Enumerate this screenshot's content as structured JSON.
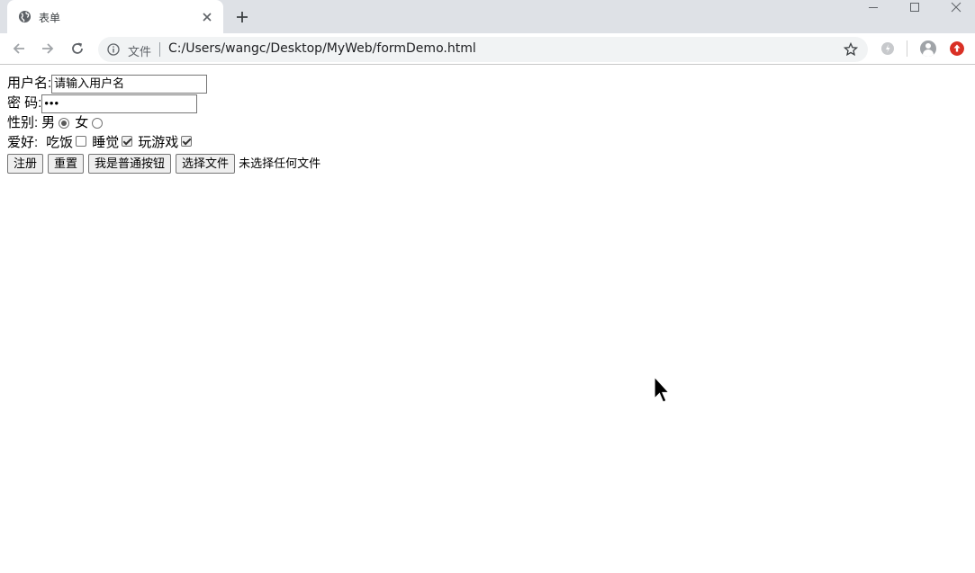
{
  "browser": {
    "tab": {
      "title": "表单"
    },
    "address_bar": {
      "scheme_label": "文件",
      "url": "C:/Users/wangc/Desktop/MyWeb/formDemo.html"
    },
    "update_color": "#d93025"
  },
  "form": {
    "username": {
      "label": "用户名:",
      "placeholder": "请输入用户名",
      "value": ""
    },
    "password": {
      "label": "密 码:",
      "masked_value": "•••"
    },
    "gender": {
      "label": "性别:",
      "options": [
        {
          "label": "男",
          "checked": true
        },
        {
          "label": "女",
          "checked": false
        }
      ]
    },
    "hobbies": {
      "label": "爱好:",
      "options": [
        {
          "label": "吃饭",
          "checked": false
        },
        {
          "label": "睡觉",
          "checked": true
        },
        {
          "label": "玩游戏",
          "checked": true
        }
      ]
    },
    "buttons": {
      "submit": "注册",
      "reset": "重置",
      "plain": "我是普通按钮",
      "file_choose": "选择文件",
      "file_status": "未选择任何文件"
    }
  }
}
